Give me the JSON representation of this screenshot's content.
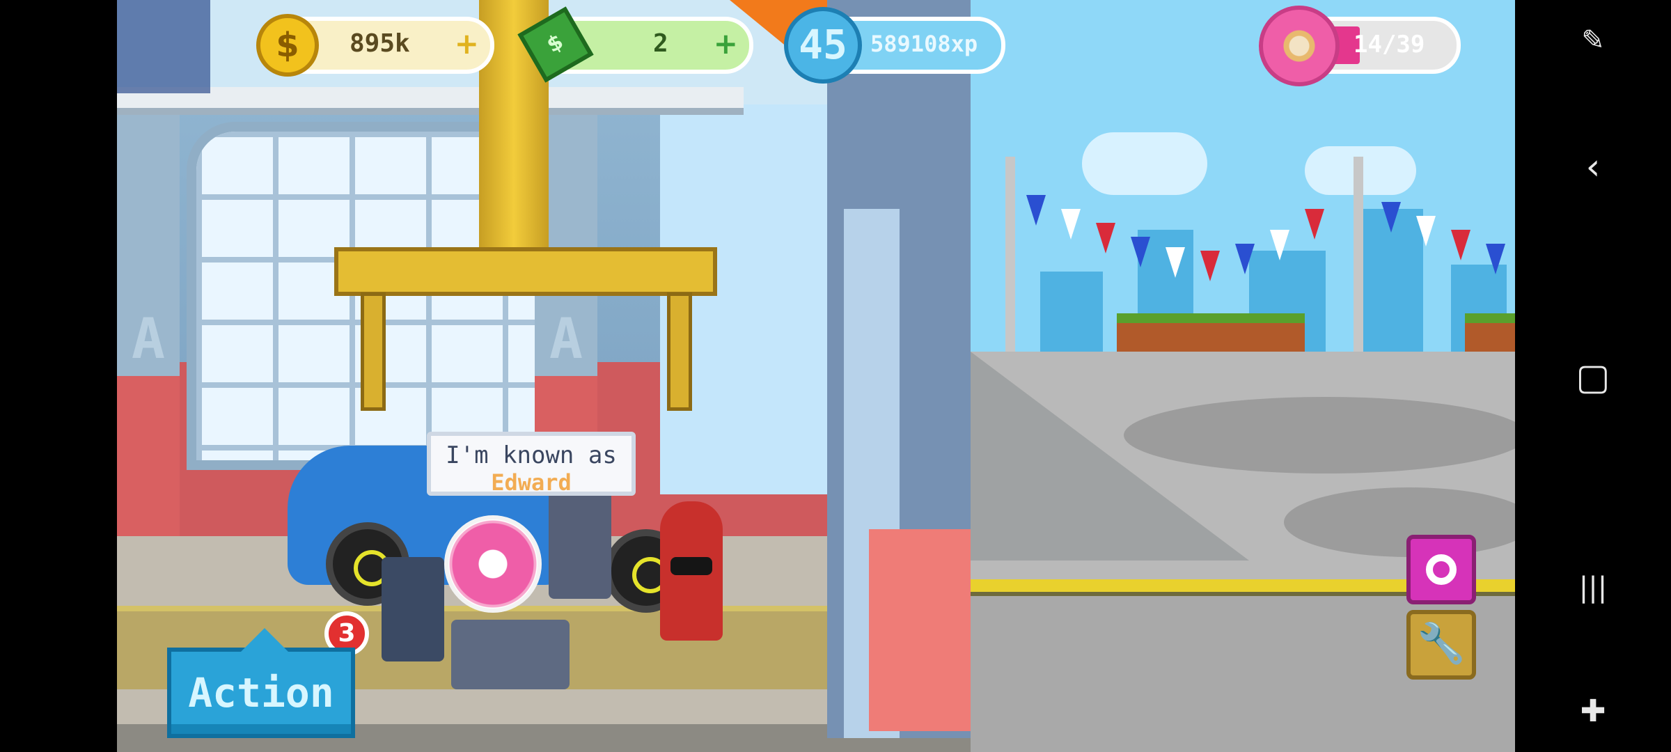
{
  "hud": {
    "coins": {
      "value": "895k",
      "icon": "coin-icon",
      "plus": "+"
    },
    "cash": {
      "value": "2",
      "icon": "cash-icon",
      "plus": "+"
    },
    "xp": {
      "level": "45",
      "value": "589108xp"
    },
    "donuts": {
      "value": "14/39",
      "progress": 0.36
    }
  },
  "dialog": {
    "line1": "I'm known as",
    "line2": "Edward"
  },
  "badge": {
    "count": "3"
  },
  "action_button": {
    "label": "Action"
  },
  "side_buttons": {
    "donut_icon": "donut-icon",
    "wrench_icon": "wrench-icon"
  },
  "navbar": {
    "screenshot_icon": "screenshot-tool-icon",
    "back": "‹",
    "home": "▢",
    "recents": "|||",
    "game_icon": "gamepad-icon"
  },
  "colors": {
    "accent_pink": "#e4378d",
    "sky": "#8fd8f8",
    "action_blue": "#2aa3d8"
  }
}
